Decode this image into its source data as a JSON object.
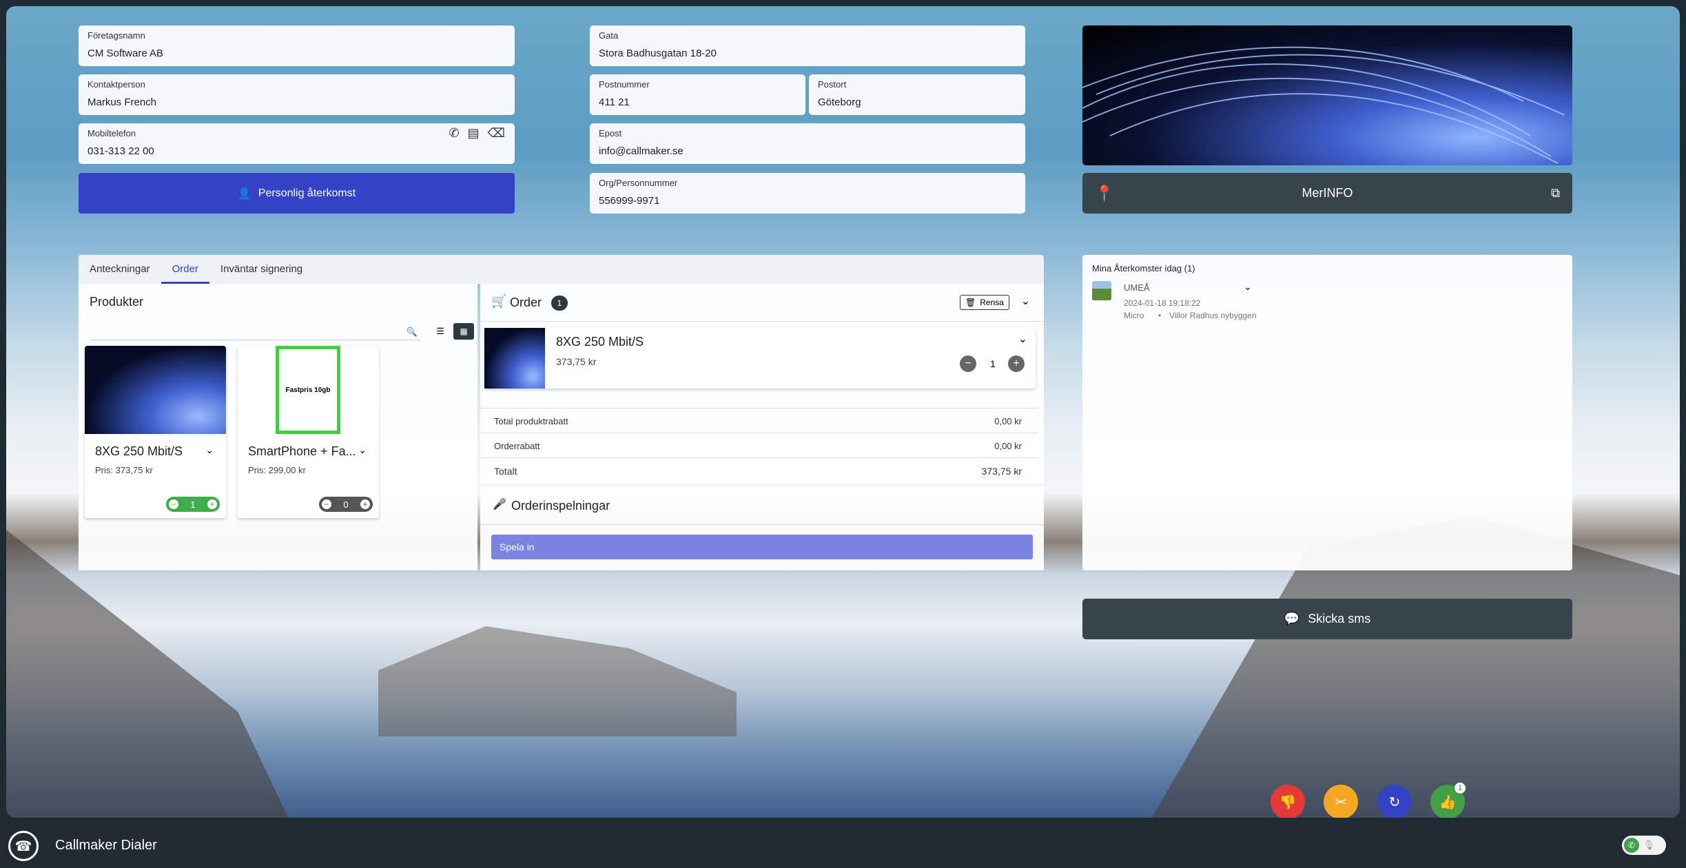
{
  "contact": {
    "company_label": "Företagsnamn",
    "company": "CM Software AB",
    "person_label": "Kontaktperson",
    "person": "Markus French",
    "mobile_label": "Mobiltelefon",
    "mobile": "031-313 22 00",
    "street_label": "Gata",
    "street": "Stora Badhusgatan 18-20",
    "zip_label": "Postnummer",
    "zip": "411 21",
    "city_label": "Postort",
    "city": "Göteborg",
    "email_label": "Epost",
    "email": "info@callmaker.se",
    "org_label": "Org/Personnummer",
    "org": "556999-9971"
  },
  "callback_button": "Personlig återkomst",
  "merinfo_label": "MerINFO",
  "tabs": [
    "Anteckningar",
    "Order",
    "Inväntar signering"
  ],
  "products": {
    "title": "Produkter",
    "items": [
      {
        "name": "8XG 250 Mbit/S",
        "price": "Pris: 373,75 kr",
        "qty": "1"
      },
      {
        "name": "SmartPhone + Fa...",
        "price": "Pris: 299,00 kr",
        "qty": "0",
        "image_text": "Fastpris 10gb"
      }
    ]
  },
  "order": {
    "title": "Order",
    "count": "1",
    "clear_label": "Rensa",
    "item": {
      "name": "8XG 250 Mbit/S",
      "price": "373,75 kr",
      "qty": "1"
    },
    "rows": [
      {
        "label": "Total produktrabatt",
        "value": "0,00 kr"
      },
      {
        "label": "Orderrabatt",
        "value": "0,00 kr"
      },
      {
        "label": "Totalt",
        "value": "373,75 kr"
      }
    ],
    "recordings_title": "Orderinspelningar",
    "record_button": "Spela in"
  },
  "callbacks": {
    "title": "Mina Återkomster idag (1)",
    "item": {
      "city": "UMEÅ",
      "time": "2024-01-18 19:18:22",
      "tag1": "Micro",
      "sep": "•",
      "tag2": "Villor Radhus nybyggen"
    }
  },
  "sms_button": "Skicka sms",
  "fab_badge": "1",
  "footer": {
    "title": "Callmaker Dialer"
  },
  "colors": {
    "primary": "#3442c6",
    "dark": "#37444c",
    "red": "#e53935",
    "orange": "#f5a623",
    "blue": "#3442c6",
    "green": "#43a047"
  }
}
